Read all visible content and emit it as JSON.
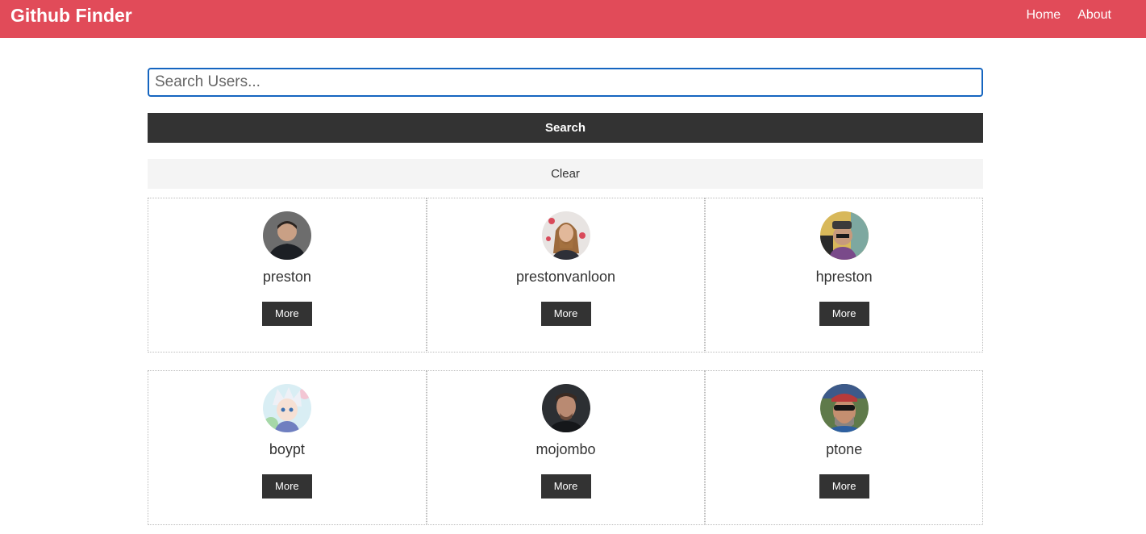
{
  "navbar": {
    "brand": "Github Finder",
    "links": [
      {
        "label": "Home"
      },
      {
        "label": "About"
      }
    ]
  },
  "search": {
    "placeholder": "Search Users...",
    "value": "",
    "search_button": "Search",
    "clear_button": "Clear"
  },
  "users": [
    {
      "login": "preston",
      "button": "More",
      "avatar": "avatar-photo"
    },
    {
      "login": "prestonvanloon",
      "button": "More",
      "avatar": "avatar-photo"
    },
    {
      "login": "hpreston",
      "button": "More",
      "avatar": "avatar-photo"
    },
    {
      "login": "boypt",
      "button": "More",
      "avatar": "avatar-anime"
    },
    {
      "login": "mojombo",
      "button": "More",
      "avatar": "avatar-photo"
    },
    {
      "login": "ptone",
      "button": "More",
      "avatar": "avatar-photo"
    }
  ],
  "colors": {
    "navbar": "#e14b59",
    "dark": "#333333",
    "light": "#f4f4f4",
    "input_border": "#1565c0"
  }
}
